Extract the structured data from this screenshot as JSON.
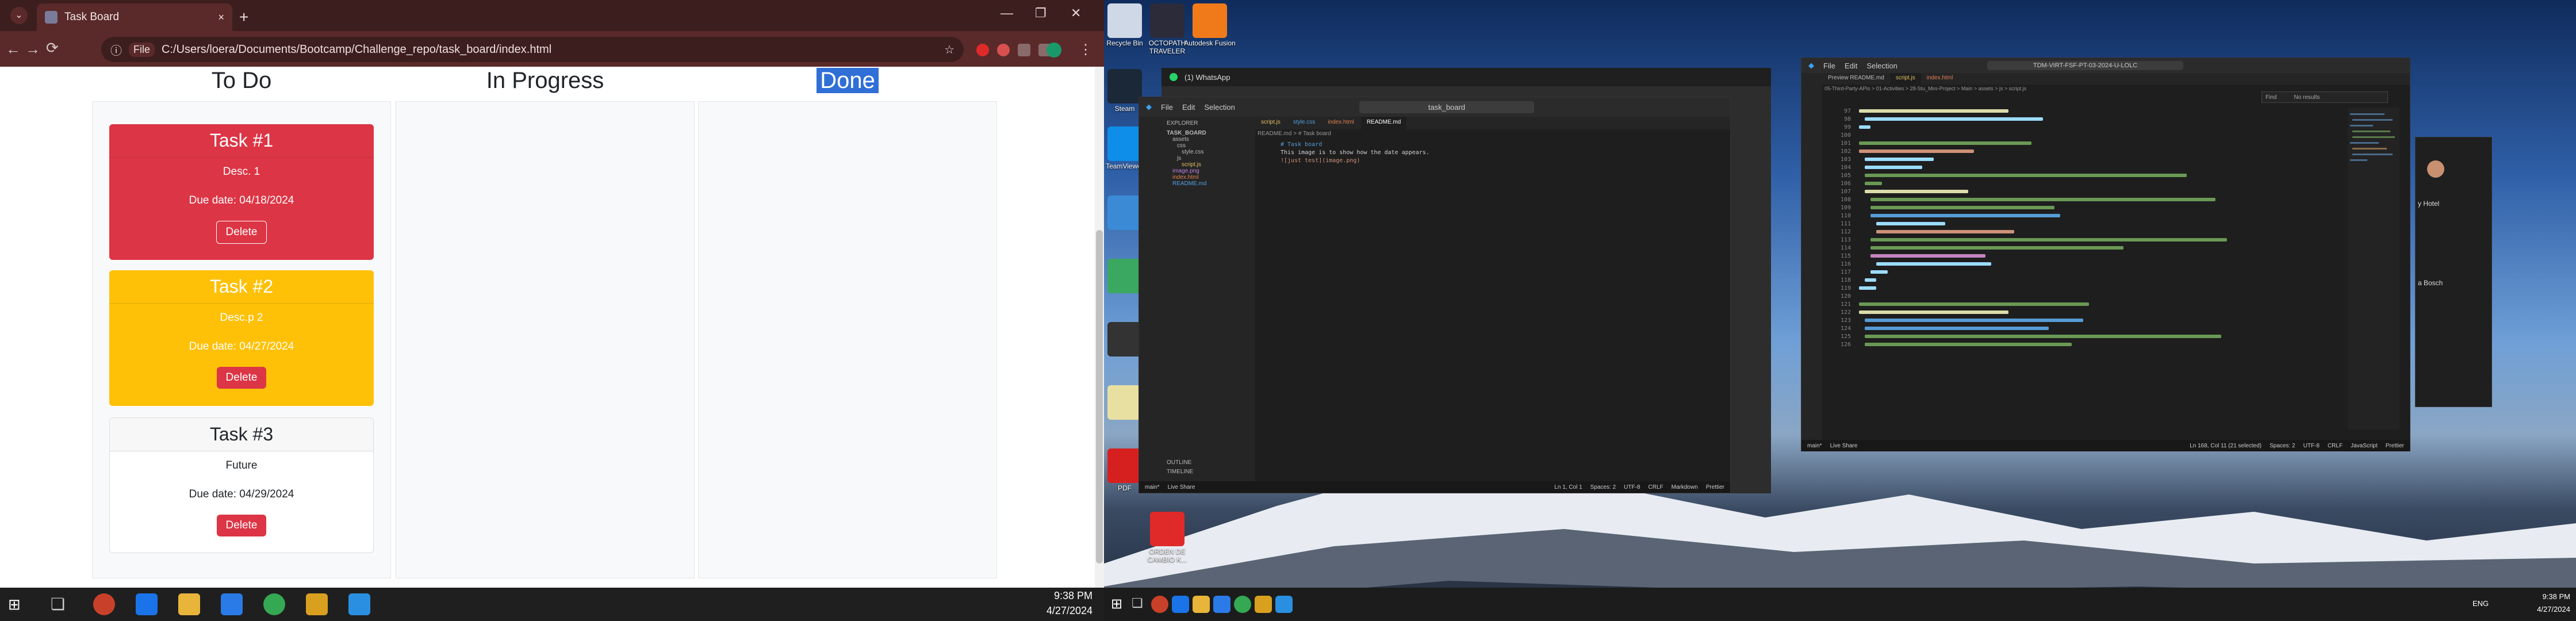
{
  "browser": {
    "tab_title": "Task Board",
    "address_label": "File",
    "url": "C:/Users/loera/Documents/Bootcamp/Challenge_repo/task_board/index.html",
    "new_tab_symbol": "+",
    "tab_close": "×",
    "back": "←",
    "forward": "→",
    "reload": "⟳"
  },
  "board": {
    "lanes": [
      {
        "title": "To Do"
      },
      {
        "title": "In Progress"
      },
      {
        "title": "Done"
      }
    ],
    "cards": [
      {
        "title": "Task #1",
        "desc": "Desc. 1",
        "due": "Due date: 04/18/2024",
        "delete": "Delete"
      },
      {
        "title": "Task #2",
        "desc": "Desc.p 2",
        "due": "Due date: 04/27/2024",
        "delete": "Delete"
      },
      {
        "title": "Task #3",
        "desc": "Future",
        "due": "Due date: 04/29/2024",
        "delete": "Delete"
      }
    ]
  },
  "taskbar_left": {
    "time": "9:38 PM",
    "date": "4/27/2024"
  },
  "desktop": {
    "icons": [
      {
        "label": "Recycle Bin"
      },
      {
        "label": "OCTOPATH TRAVELER"
      },
      {
        "label": "Autodesk Fusion"
      },
      {
        "label": "Steam"
      },
      {
        "label": "TeamViewer"
      },
      {
        "label": "PDF"
      },
      {
        "label": "ORDEN DE CAMBIO K..."
      }
    ]
  },
  "whatsapp": {
    "title": "(1) WhatsApp",
    "hotel_label": "y Hotel",
    "bosch_label": "a Bosch"
  },
  "vscode_mid": {
    "search": "task_board",
    "explorer_title": "EXPLORER",
    "root": "TASK_BOARD",
    "tree": [
      "assets",
      "css",
      "style.css",
      "js",
      "script.js",
      "image.png",
      "index.html",
      "README.md"
    ],
    "tabs": [
      "script.js",
      "style.css",
      "index.html",
      "README.md"
    ],
    "breadcrumb": "README.md > # Task board",
    "code_lines": [
      "# Task board",
      "",
      "",
      "This image is to show how the date appears.",
      "![just test](image.png)"
    ],
    "outline": "OUTLINE",
    "timeline": "TIMELINE",
    "status_branch": "main*",
    "status_pos": "Ln 1, Col 1",
    "status_spaces": "Spaces: 2",
    "status_enc": "UTF-8",
    "status_eol": "CRLF",
    "status_lang": "Markdown",
    "status_live": "Live Share",
    "status_prettier": "Prettier"
  },
  "vscode_right": {
    "menu": [
      "File",
      "Edit",
      "Selection"
    ],
    "search": "TDM-VIRT-FSF-PT-03-2024-U-LOLC",
    "tabs": [
      "Preview README.md",
      "script.js",
      "index.html"
    ],
    "breadcrumb": "05-Third-Party-APIs > 01-Activities > 28-Stu_Mini-Project > Main > assets > js > script.js",
    "find_placeholder": "Find",
    "find_result": "No results",
    "line_numbers": [
      "97",
      "98",
      "99",
      "100",
      "101",
      "102",
      "103",
      "104",
      "105",
      "106",
      "107",
      "108",
      "109",
      "110",
      "111",
      "112",
      "113",
      "114",
      "115",
      "116",
      "117",
      "118",
      "119",
      "120",
      "121",
      "122",
      "123",
      "124",
      "125",
      "126"
    ],
    "status_branch": "main*",
    "status_pos": "Ln 168, Col 11 (21 selected)",
    "status_spaces": "Spaces: 2",
    "status_enc": "UTF-8",
    "status_eol": "CRLF",
    "status_lang": "JavaScript",
    "status_live": "Live Share",
    "status_prettier": "Prettier"
  },
  "taskbar_right": {
    "lang": "ENG",
    "time": "9:38 PM",
    "date": "4/27/2024"
  }
}
